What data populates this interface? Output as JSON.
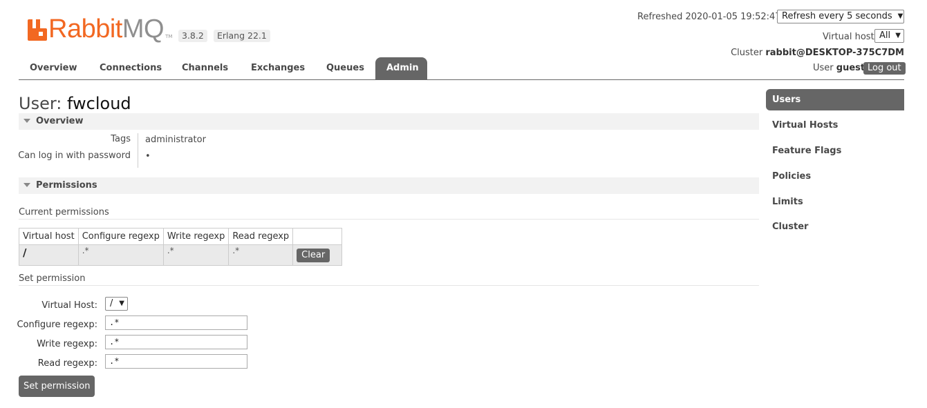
{
  "brand": {
    "logo_rabbit": "Rabbit",
    "logo_mq": "MQ",
    "logo_tm": "TM",
    "version": "3.8.2",
    "erlang": "Erlang 22.1",
    "accent_color": "#f26822"
  },
  "status": {
    "refreshed": "Refreshed 2020-01-05 19:52:47",
    "refresh_option": "Refresh every 5 seconds",
    "vhost_label": "Virtual host",
    "vhost_value": "All",
    "cluster_label": "Cluster",
    "cluster_value": "rabbit@DESKTOP-375C7DM",
    "user_label": "User",
    "user_value": "guest",
    "logout": "Log out"
  },
  "nav": {
    "tabs": [
      "Overview",
      "Connections",
      "Channels",
      "Exchanges",
      "Queues",
      "Admin"
    ],
    "active": "Admin"
  },
  "page": {
    "title_prefix": "User:",
    "title_name": "fwcloud"
  },
  "overview": {
    "heading": "Overview",
    "tags_label": "Tags",
    "tags_value": "administrator",
    "login_label": "Can log in with password",
    "login_value": "•"
  },
  "permissions": {
    "heading": "Permissions",
    "current_label": "Current permissions",
    "columns": [
      "Virtual host",
      "Configure regexp",
      "Write regexp",
      "Read regexp"
    ],
    "row": {
      "vhost": "/",
      "configure": ".*",
      "write": ".*",
      "read": ".*",
      "action": "Clear"
    },
    "set_label": "Set permission"
  },
  "form": {
    "vhost_label": "Virtual Host:",
    "vhost_value": "/",
    "configure_label": "Configure regexp:",
    "configure_value": ".*",
    "write_label": "Write regexp:",
    "write_value": ".*",
    "read_label": "Read regexp:",
    "read_value": ".*",
    "submit": "Set permission"
  },
  "sidebar": {
    "items": [
      "Users",
      "Virtual Hosts",
      "Feature Flags",
      "Policies",
      "Limits",
      "Cluster"
    ],
    "active": "Users"
  }
}
